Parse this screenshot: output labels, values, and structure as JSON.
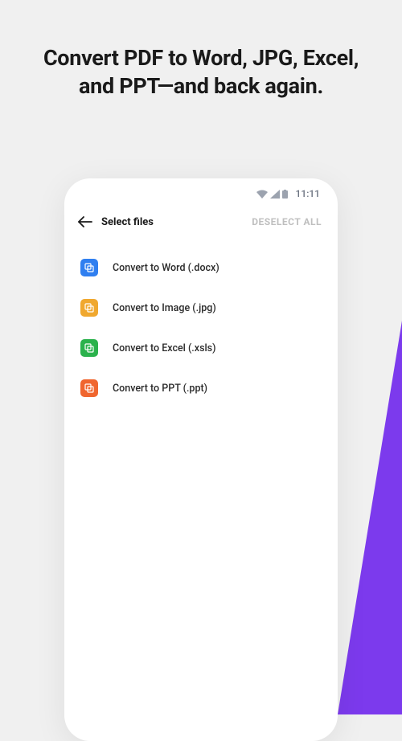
{
  "headline": "Convert PDF to Word, JPG, Excel, and PPT—and back again.",
  "status": {
    "time": "11:11"
  },
  "header": {
    "title": "Select files",
    "deselect": "DESELECT ALL"
  },
  "options": [
    {
      "label": "Convert to Word (.docx)",
      "icon": "word",
      "color": "#2f7ff0"
    },
    {
      "label": "Convert to Image (.jpg)",
      "icon": "image",
      "color": "#f0a82f"
    },
    {
      "label": "Convert to Excel (.xsls)",
      "icon": "excel",
      "color": "#2bb24c"
    },
    {
      "label": "Convert to PPT (.ppt)",
      "icon": "ppt",
      "color": "#f0662f"
    }
  ]
}
